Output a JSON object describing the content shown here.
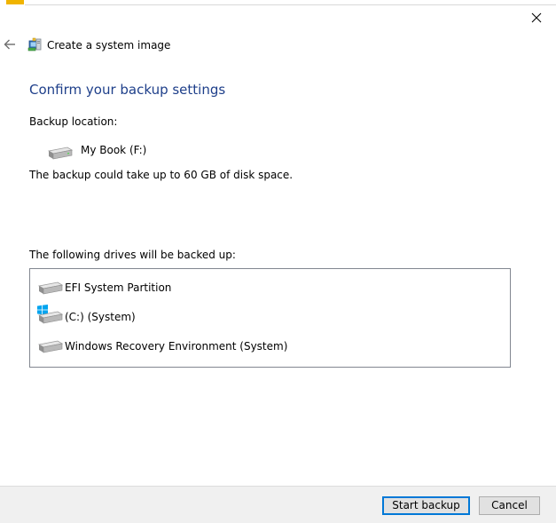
{
  "window": {
    "title": "Create a system image",
    "accent_color": "#f0b400"
  },
  "page": {
    "heading": "Confirm your backup settings",
    "heading_color": "#1e3f8a"
  },
  "backup": {
    "location_label": "Backup location:",
    "location_name": "My Book (F:)",
    "space_note": "The backup could take up to 60 GB of disk space."
  },
  "drives": {
    "header": "The following drives will be backed up:",
    "items": [
      {
        "label": "EFI System Partition",
        "icon": "hard-drive-icon"
      },
      {
        "label": "(C:) (System)",
        "icon": "system-drive-icon"
      },
      {
        "label": "Windows Recovery Environment (System)",
        "icon": "hard-drive-icon"
      }
    ]
  },
  "footer": {
    "start_label": "Start backup",
    "cancel_label": "Cancel"
  }
}
